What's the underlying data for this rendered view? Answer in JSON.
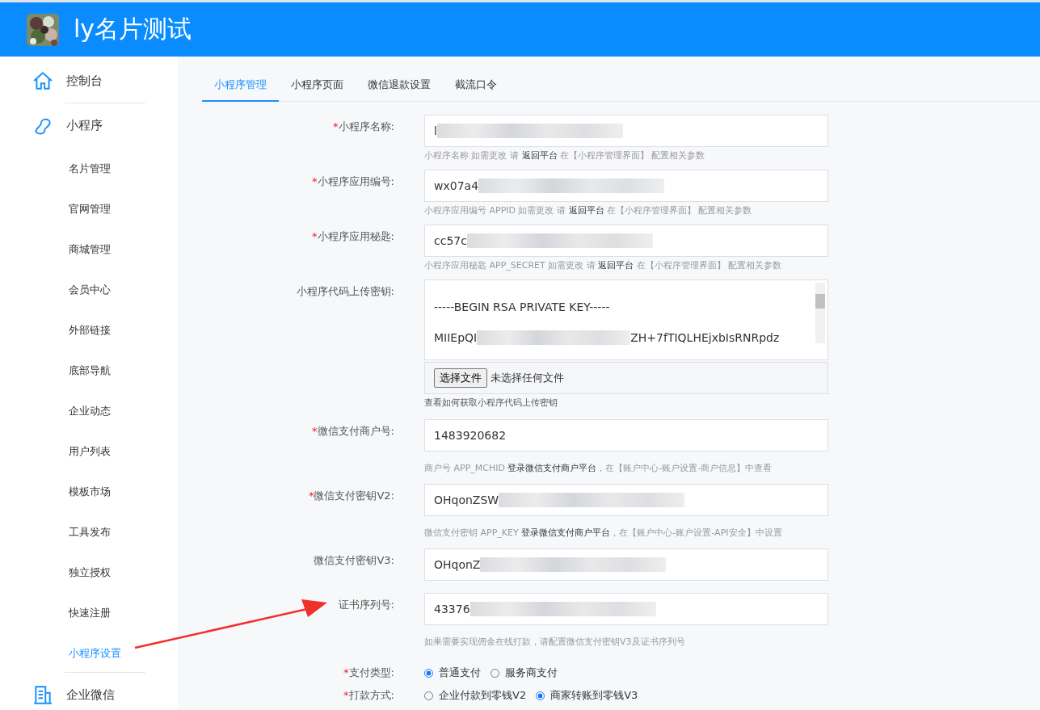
{
  "header": {
    "title": "ly名片测试"
  },
  "sidebar": {
    "items": [
      {
        "label": "控制台",
        "selected": false
      },
      {
        "label": "小程序",
        "selected": false,
        "children": [
          {
            "label": "名片管理",
            "selected": false
          },
          {
            "label": "官网管理",
            "selected": false
          },
          {
            "label": "商城管理",
            "selected": false
          },
          {
            "label": "会员中心",
            "selected": false
          },
          {
            "label": "外部链接",
            "selected": false
          },
          {
            "label": "底部导航",
            "selected": false
          },
          {
            "label": "企业动态",
            "selected": false
          },
          {
            "label": "用户列表",
            "selected": false
          },
          {
            "label": "模板市场",
            "selected": false
          },
          {
            "label": "工具发布",
            "selected": false
          },
          {
            "label": "独立授权",
            "selected": false
          },
          {
            "label": "快速注册",
            "selected": false
          },
          {
            "label": "小程序设置",
            "selected": true
          }
        ]
      },
      {
        "label": "企业微信",
        "selected": false
      }
    ]
  },
  "tabs": [
    {
      "label": "小程序管理",
      "selected": true
    },
    {
      "label": "小程序页面",
      "selected": false
    },
    {
      "label": "微信退款设置",
      "selected": false
    },
    {
      "label": "截流口令",
      "selected": false
    }
  ],
  "form": {
    "fields": [
      {
        "kind": "text",
        "label": "小程序名称:",
        "mark": "*",
        "value": "l",
        "redacted": true,
        "help": "小程序名称 如需更改 请 **返回平台** 在【小程序管理界面】 配置相关参数"
      },
      {
        "kind": "text",
        "label": "小程序应用编号:",
        "mark": "*",
        "value": "wx07a4",
        "redacted": true,
        "help": "小程序应用编号 APPID 如需更改 请 **返回平台** 在【小程序管理界面】 配置相关参数"
      },
      {
        "kind": "text",
        "label": "小程序应用秘匙:",
        "mark": "*",
        "value": "cc57c",
        "redacted": true,
        "help": "小程序应用秘匙 APP_SECRET 如需更改 请 **返回平台** 在【小程序管理界面】 配置相关参数"
      },
      {
        "kind": "textarea",
        "label": "小程序代码上传密钥:",
        "lines": [
          {
            "text": "-----BEGIN RSA PRIVATE KEY-----",
            "redacted": false
          },
          {
            "text": "MIIEpQI",
            "redacted": true,
            "tail": "ZH+7fTIQLHEjxbIsRNRpdz"
          }
        ],
        "file_button": "选择文件",
        "file_status": "未选择任何文件",
        "help": "查看如何获取小程序代码上传密钥"
      },
      {
        "kind": "text",
        "label": "微信支付商户号:",
        "mark": "*",
        "value": "1483920682",
        "redacted": false,
        "help": "商户号 APP_MCHID **登录微信支付商户平台**，在【账户中心-账户设置-商户信息】中查看"
      },
      {
        "kind": "text",
        "label": "微信支付密钥V2:",
        "mark": "*",
        "value": "OHqonZSW",
        "redacted": true,
        "help": "微信支付密钥 APP_KEY **登录微信支付商户平台**，在【账户中心-账户设置-API安全】中设置"
      },
      {
        "kind": "text",
        "label": "微信支付密钥V3:",
        "value": "OHqonZ",
        "redacted": true
      },
      {
        "kind": "text",
        "label": "证书序列号:",
        "value": "43376",
        "redacted": true,
        "help": "如果需要实现佣金在线打款，请配置微信支付密钥V3及证书序列号"
      },
      {
        "kind": "radio",
        "label": "支付类型:",
        "mark": "*",
        "options": [
          {
            "label": "普通支付",
            "selected": true
          },
          {
            "label": "服务商支付",
            "selected": false
          }
        ]
      },
      {
        "kind": "radio",
        "label": "打款方式:",
        "mark": "*",
        "options": [
          {
            "label": "企业付款到零钱V2",
            "selected": false
          },
          {
            "label": "商家转账到零钱V3",
            "selected": true
          }
        ]
      }
    ]
  }
}
